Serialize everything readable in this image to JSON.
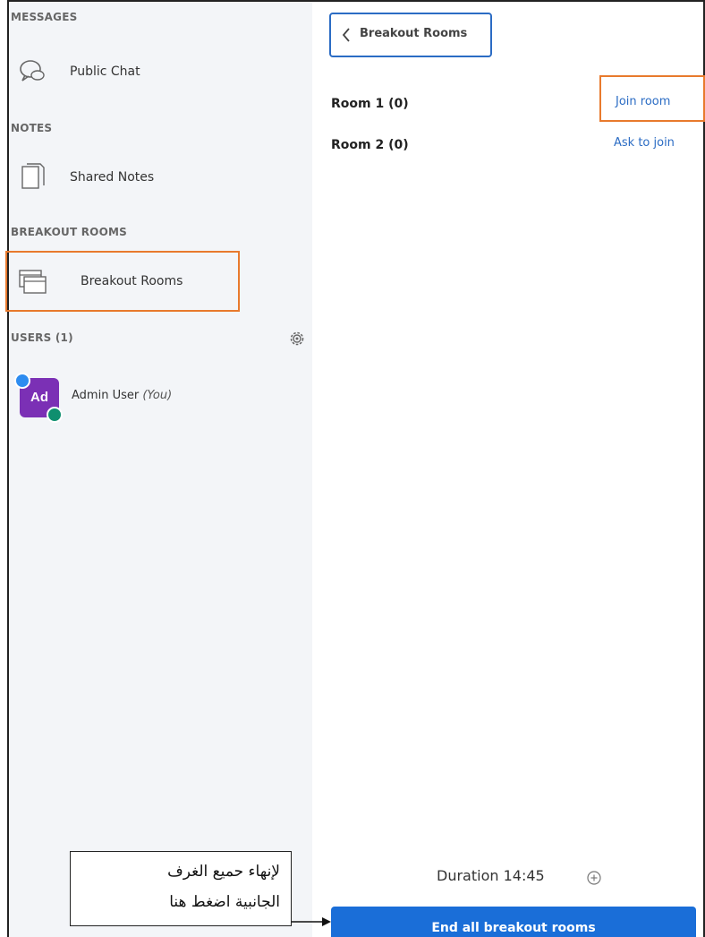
{
  "sidebar": {
    "messages_title": "MESSAGES",
    "public_chat_label": "Public Chat",
    "notes_title": "NOTES",
    "shared_notes_label": "Shared Notes",
    "breakout_title": "BREAKOUT ROOMS",
    "breakout_label": "Breakout Rooms",
    "users_title": "USERS (1)",
    "user": {
      "initials": "Ad",
      "name": "Admin User",
      "you_tag": "(You)"
    }
  },
  "main": {
    "back_label": "Breakout Rooms",
    "rooms": [
      {
        "name": "Room 1 (0)",
        "action": "Join room"
      },
      {
        "name": "Room 2 (0)",
        "action": "Ask to join"
      }
    ],
    "duration": "Duration 14:45",
    "end_button_label": "End all breakout rooms"
  },
  "annotation": {
    "line1": "لإنهاء حميع الغرف",
    "line2": "الجانبية اضغط هنا"
  },
  "colors": {
    "accent": "#1a6ed8",
    "highlight": "#e87a2d",
    "avatar": "#7b30b5",
    "sidebar_bg": "#f3f5f8"
  },
  "icons": [
    "chat-icon",
    "notes-icon",
    "breakout-rooms-icon",
    "gear-icon",
    "chevron-left-icon",
    "plus-circle-icon"
  ]
}
